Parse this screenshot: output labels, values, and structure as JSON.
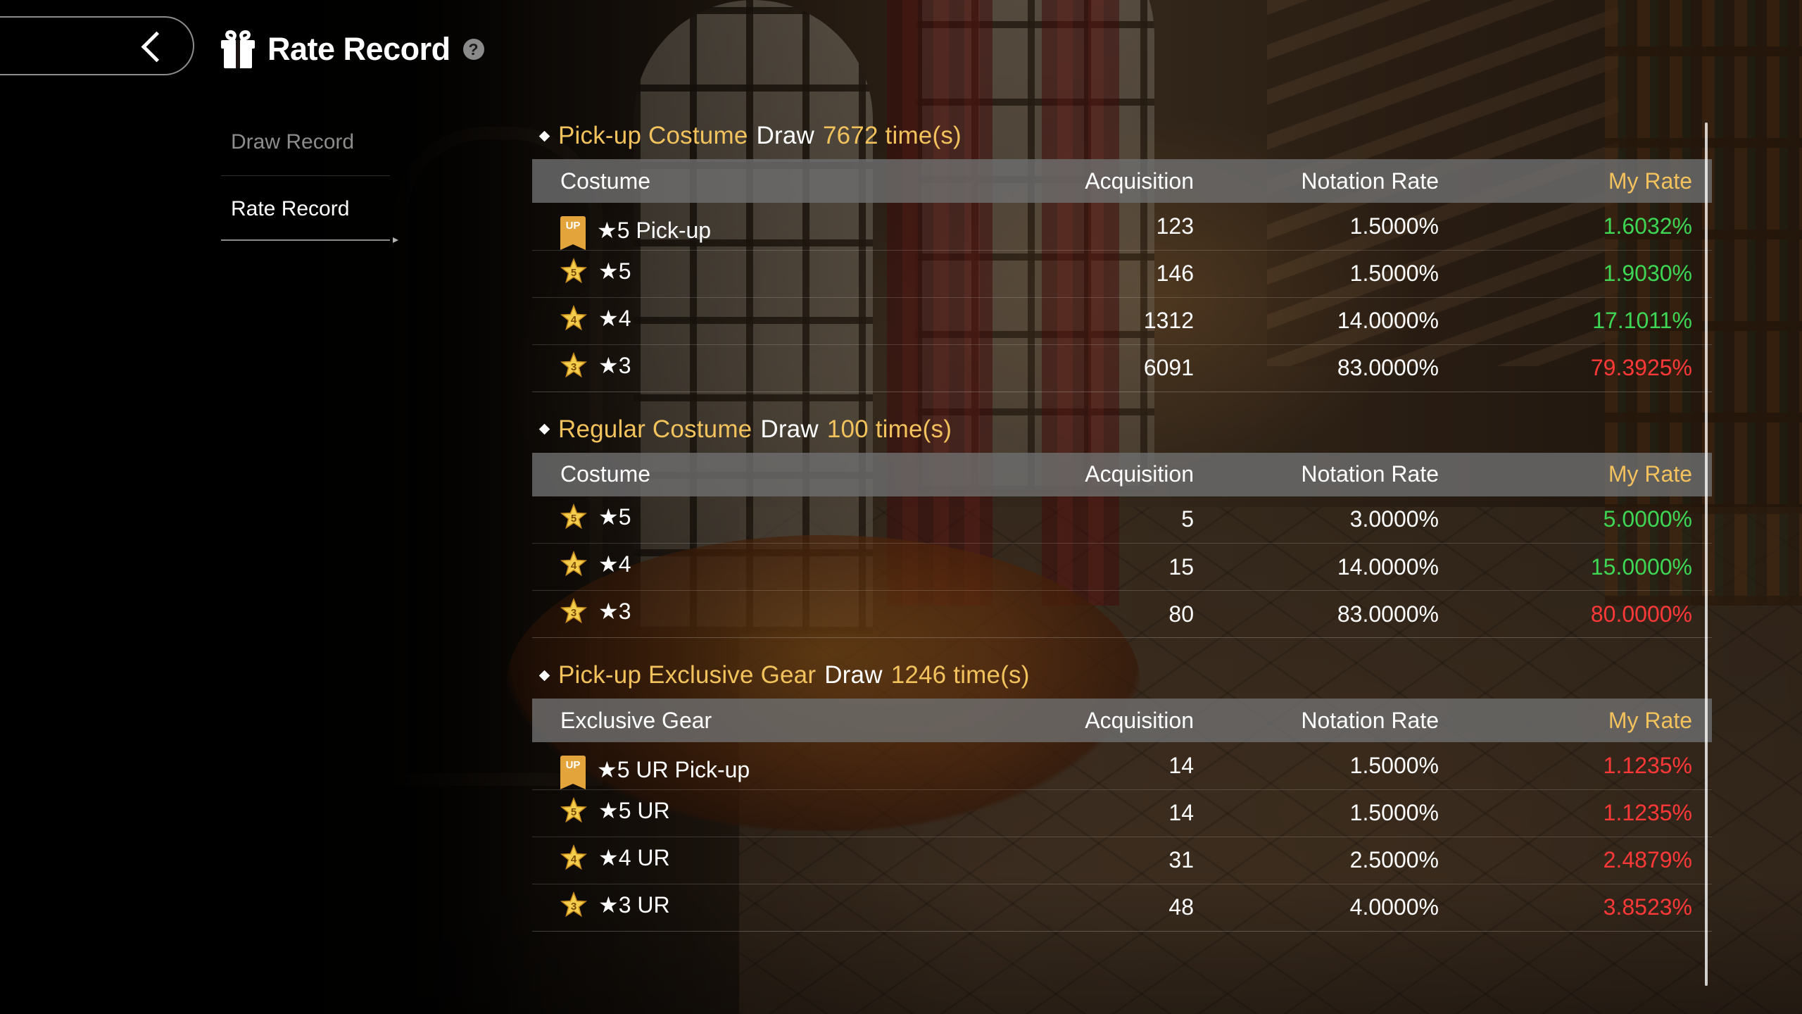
{
  "header": {
    "title": "Rate Record",
    "help_icon": "question-icon",
    "back_icon": "chevron-left-icon"
  },
  "side_nav": {
    "items": [
      {
        "label": "Draw Record",
        "active": false
      },
      {
        "label": "Rate Record",
        "active": true
      }
    ]
  },
  "colors": {
    "gold": "#f2c25d",
    "green": "#3dd655",
    "red": "#ff3838",
    "header_bar": "#6e6e6e"
  },
  "sections": [
    {
      "title_pre": "Pick-up Costume",
      "title_mid": "Draw",
      "title_post": "7672 time(s)",
      "columns": [
        "Costume",
        "Acquisition",
        "Notation Rate",
        "My Rate"
      ],
      "rows": [
        {
          "badge": "up-badge",
          "label": "★5 Pick-up",
          "acquisition": "123",
          "notation": "1.5000%",
          "my_rate": "1.6032%",
          "status": "green"
        },
        {
          "badge": "star5-badge",
          "label": "★5",
          "acquisition": "146",
          "notation": "1.5000%",
          "my_rate": "1.9030%",
          "status": "green"
        },
        {
          "badge": "star4-badge",
          "label": "★4",
          "acquisition": "1312",
          "notation": "14.0000%",
          "my_rate": "17.1011%",
          "status": "green"
        },
        {
          "badge": "star3-badge",
          "label": "★3",
          "acquisition": "6091",
          "notation": "83.0000%",
          "my_rate": "79.3925%",
          "status": "red"
        }
      ]
    },
    {
      "title_pre": "Regular Costume",
      "title_mid": "Draw",
      "title_post": "100 time(s)",
      "columns": [
        "Costume",
        "Acquisition",
        "Notation Rate",
        "My Rate"
      ],
      "rows": [
        {
          "badge": "star5-badge",
          "label": "★5",
          "acquisition": "5",
          "notation": "3.0000%",
          "my_rate": "5.0000%",
          "status": "green"
        },
        {
          "badge": "star4-badge",
          "label": "★4",
          "acquisition": "15",
          "notation": "14.0000%",
          "my_rate": "15.0000%",
          "status": "green"
        },
        {
          "badge": "star3-badge",
          "label": "★3",
          "acquisition": "80",
          "notation": "83.0000%",
          "my_rate": "80.0000%",
          "status": "red"
        }
      ]
    },
    {
      "title_pre": "Pick-up Exclusive Gear",
      "title_mid": "Draw",
      "title_post": "1246 time(s)",
      "columns": [
        "Exclusive Gear",
        "Acquisition",
        "Notation Rate",
        "My Rate"
      ],
      "rows": [
        {
          "badge": "up-badge",
          "label": "★5 UR Pick-up",
          "acquisition": "14",
          "notation": "1.5000%",
          "my_rate": "1.1235%",
          "status": "red"
        },
        {
          "badge": "star5-badge",
          "label": "★5 UR",
          "acquisition": "14",
          "notation": "1.5000%",
          "my_rate": "1.1235%",
          "status": "red"
        },
        {
          "badge": "star4-badge",
          "label": "★4 UR",
          "acquisition": "31",
          "notation": "2.5000%",
          "my_rate": "2.4879%",
          "status": "red"
        },
        {
          "badge": "star3-badge",
          "label": "★3 UR",
          "acquisition": "48",
          "notation": "4.0000%",
          "my_rate": "3.8523%",
          "status": "red"
        }
      ]
    }
  ],
  "badge_text": {
    "up-badge": "UP",
    "star5-badge": "5",
    "star4-badge": "4",
    "star3-badge": "3"
  }
}
